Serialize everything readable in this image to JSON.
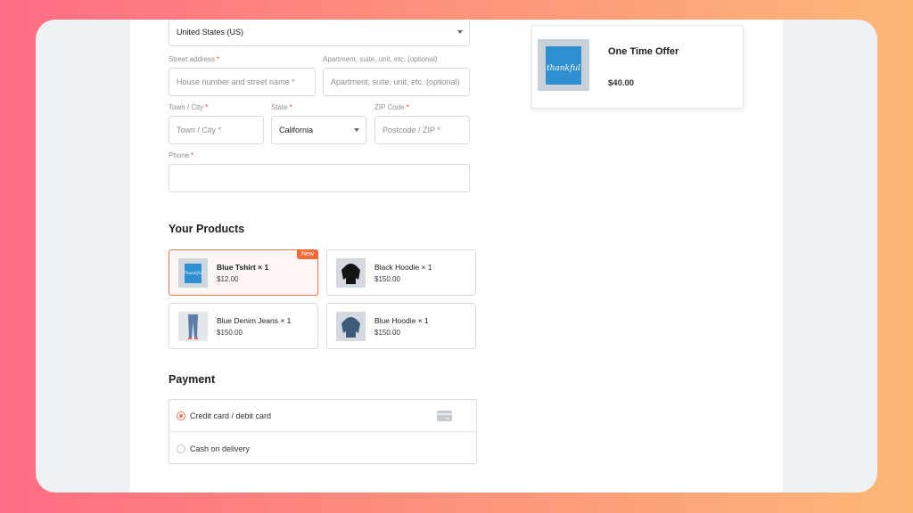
{
  "address": {
    "country_value": "United States (US)",
    "street_label": "Street address",
    "street_placeholder": "House number and street name *",
    "apartment_label": "Apartment, suite, unit, etc. (optional)",
    "apartment_placeholder": "Apartment, suite, unit, etc. (optional)",
    "city_label": "Town / City",
    "city_placeholder": "Town / City *",
    "state_label": "State",
    "state_value": "California",
    "zip_label": "ZIP Code",
    "zip_placeholder": "Postcode / ZIP *",
    "phone_label": "Phone",
    "required_mark": "*"
  },
  "products": {
    "title": "Your Products",
    "badge": "New",
    "items": [
      {
        "name": "Blue Tshirt × 1",
        "price": "$12.00"
      },
      {
        "name": "Black Hoodie × 1",
        "price": "$150.00"
      },
      {
        "name": "Blue Denim Jeans × 1",
        "price": "$150.00"
      },
      {
        "name": "Blue Hoodie × 1",
        "price": "$150.00"
      }
    ]
  },
  "payment": {
    "title": "Payment",
    "options": [
      {
        "label": "Credit card / debit card",
        "selected": true
      },
      {
        "label": "Cash on delivery",
        "selected": false
      }
    ]
  },
  "offer": {
    "title": "One Time Offer",
    "price": "$40.00",
    "image_text": "thankful"
  },
  "colors": {
    "accent": "#f07a55",
    "badge": "#f06a3c",
    "required": "#e33b2e"
  },
  "icons": {
    "card": "credit-card-icon",
    "select": "chevron-down-icon"
  }
}
